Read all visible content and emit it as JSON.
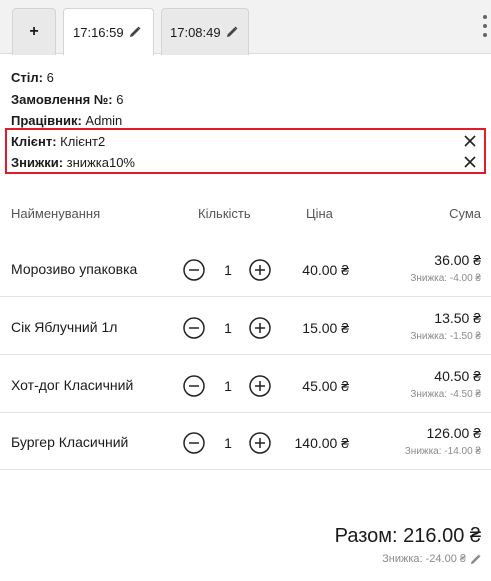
{
  "tabs": {
    "add_label": "+",
    "items": [
      {
        "label": "17:16:59",
        "active": true
      },
      {
        "label": "17:08:49",
        "active": false
      }
    ]
  },
  "order": {
    "table_label": "Стіл:",
    "table_value": "6",
    "order_label": "Замовлення №:",
    "order_value": "6",
    "worker_label": "Працівник:",
    "worker_value": "Admin",
    "client_label": "Клієнт:",
    "client_value": "Клієнт2",
    "discount_label": "Знижки:",
    "discount_value": "знижка10%"
  },
  "table": {
    "headers": {
      "name": "Найменування",
      "qty": "Кількість",
      "price": "Ціна",
      "sum": "Сума"
    },
    "rows": [
      {
        "name": "Морозиво упаковка",
        "qty": "1",
        "price": "40.00 ₴",
        "sum": "36.00 ₴",
        "discount": "Знижка: -4.00 ₴"
      },
      {
        "name": "Сік Яблучний 1л",
        "qty": "1",
        "price": "15.00 ₴",
        "sum": "13.50 ₴",
        "discount": "Знижка: -1.50 ₴"
      },
      {
        "name": "Хот-дог Класичний",
        "qty": "1",
        "price": "45.00 ₴",
        "sum": "40.50 ₴",
        "discount": "Знижка: -4.50 ₴"
      },
      {
        "name": "Бургер Класичний",
        "qty": "1",
        "price": "140.00 ₴",
        "sum": "126.00 ₴",
        "discount": "Знижка: -14.00 ₴"
      }
    ]
  },
  "total": {
    "label": "Разом: 216.00 ₴",
    "discount": "Знижка: -24.00 ₴"
  },
  "colors": {
    "highlight_border": "#e21b2b",
    "muted": "#8a8a8a"
  },
  "icons": [
    "pencil-icon",
    "close-icon",
    "minus-circle-icon",
    "plus-circle-icon",
    "kebab-menu-icon"
  ]
}
